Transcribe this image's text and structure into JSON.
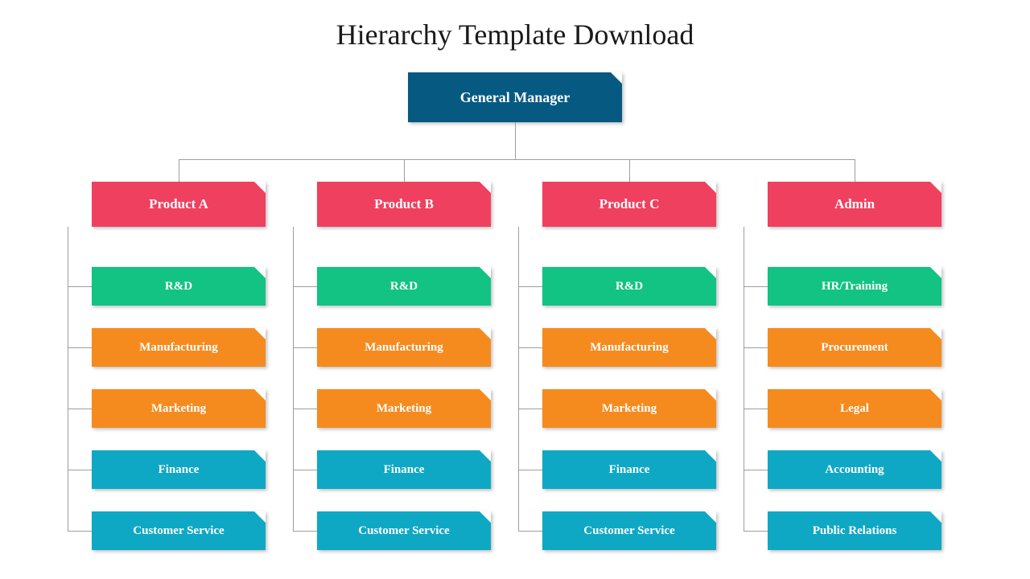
{
  "title": "Hierarchy Template Download",
  "colors": {
    "root": "#065a82",
    "category": "#ef4060",
    "green": "#12c383",
    "orange": "#f58b1f",
    "teal": "#0fa8c4"
  },
  "root": {
    "label": "General Manager"
  },
  "columns": [
    {
      "head": "Product A",
      "items": [
        {
          "label": "R&D",
          "color": "green"
        },
        {
          "label": "Manufacturing",
          "color": "orange"
        },
        {
          "label": "Marketing",
          "color": "orange"
        },
        {
          "label": "Finance",
          "color": "teal"
        },
        {
          "label": "Customer Service",
          "color": "teal"
        }
      ]
    },
    {
      "head": "Product B",
      "items": [
        {
          "label": "R&D",
          "color": "green"
        },
        {
          "label": "Manufacturing",
          "color": "orange"
        },
        {
          "label": "Marketing",
          "color": "orange"
        },
        {
          "label": "Finance",
          "color": "teal"
        },
        {
          "label": "Customer Service",
          "color": "teal"
        }
      ]
    },
    {
      "head": "Product C",
      "items": [
        {
          "label": "R&D",
          "color": "green"
        },
        {
          "label": "Manufacturing",
          "color": "orange"
        },
        {
          "label": "Marketing",
          "color": "orange"
        },
        {
          "label": "Finance",
          "color": "teal"
        },
        {
          "label": "Customer Service",
          "color": "teal"
        }
      ]
    },
    {
      "head": "Admin",
      "items": [
        {
          "label": "HR/Training",
          "color": "green"
        },
        {
          "label": "Procurement",
          "color": "orange"
        },
        {
          "label": "Legal",
          "color": "orange"
        },
        {
          "label": "Accounting",
          "color": "teal"
        },
        {
          "label": "Public Relations",
          "color": "teal"
        }
      ]
    }
  ]
}
